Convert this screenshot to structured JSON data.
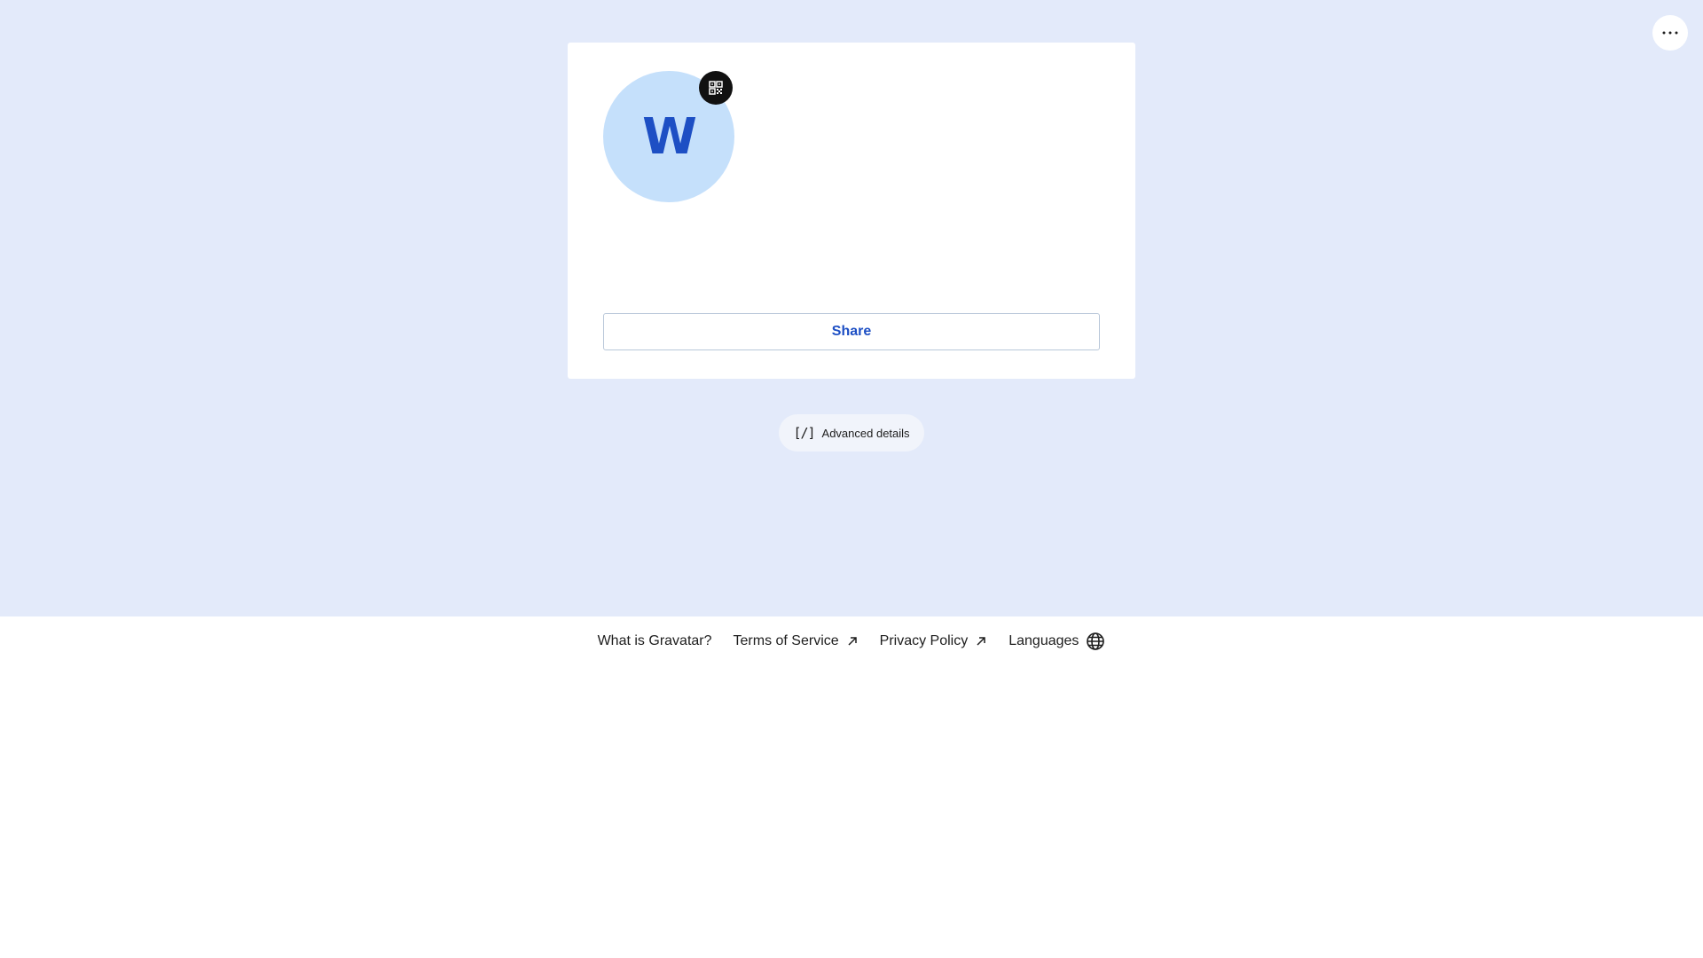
{
  "header": {
    "more_icon": "ellipsis-icon"
  },
  "profile": {
    "avatar_initial": "W",
    "avatar_bg_color": "#c5e0fb",
    "avatar_text_color": "#1d4fc4",
    "qr_icon": "qr-code-icon",
    "share_label": "Share",
    "share_color": "#1d4fc4"
  },
  "advanced": {
    "icon_text": "[/]",
    "label": "Advanced details"
  },
  "footer": {
    "links": [
      {
        "label": "What is Gravatar?",
        "icon": ""
      },
      {
        "label": "Terms of Service",
        "icon": "external-arrow-icon"
      },
      {
        "label": "Privacy Policy",
        "icon": "external-arrow-icon"
      },
      {
        "label": "Languages",
        "icon": "globe-icon"
      }
    ]
  },
  "colors": {
    "page_bg": "#e3eafa",
    "card_bg": "#ffffff",
    "qr_button_bg": "#111111",
    "text": "#1d1d1d"
  }
}
